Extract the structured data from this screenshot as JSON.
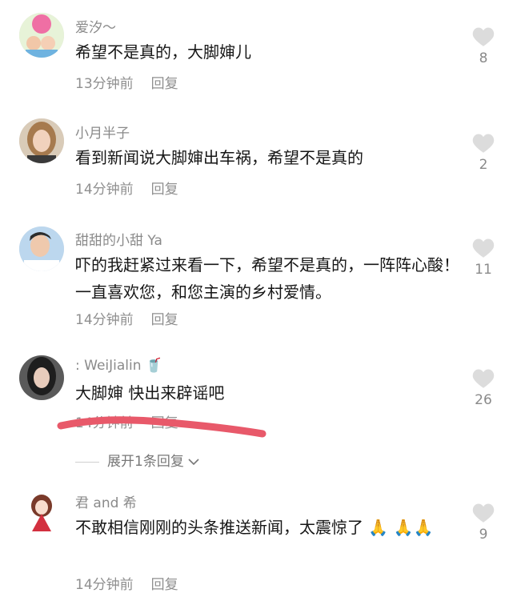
{
  "comments": [
    {
      "username": "爱汐～",
      "text": "希望不是真的，大脚婶儿",
      "time": "13分钟前",
      "reply": "回复",
      "likes": "8",
      "avatar": "kids-photo-avatar"
    },
    {
      "username": "小月半子",
      "text": "看到新闻说大脚婶出车祸，希望不是真的",
      "time": "14分钟前",
      "reply": "回复",
      "likes": "2",
      "avatar": "woman-photo-avatar"
    },
    {
      "username": "甜甜的小甜 Ya",
      "text": "吓的我赶紧过来看一下，希望不是真的，一阵阵心酸！一直喜欢您，和您主演的乡村爱情。",
      "time": "14分钟前",
      "reply": "回复",
      "likes": "11",
      "avatar": "man-photo-avatar"
    },
    {
      "username": ": WeiJialin 🥤",
      "text": "大脚婶 快出来辟谣吧",
      "time": "14分钟前",
      "reply": "回复",
      "likes": "26",
      "avatar": "girl-photo-avatar"
    },
    {
      "username": "君 and 希",
      "text": "不敢相信刚刚的头条推送新闻，太震惊了 🙏 🙏🙏",
      "time": "14分钟前",
      "reply": "回复",
      "likes": "9",
      "avatar": "cartoon-girl-avatar"
    }
  ],
  "expand_replies": "展开1条回复",
  "colors": {
    "username": "#8a8a8a",
    "meta": "#8f8f8f",
    "heart": "#d9d9d9",
    "red_stroke": "#e8596a"
  }
}
